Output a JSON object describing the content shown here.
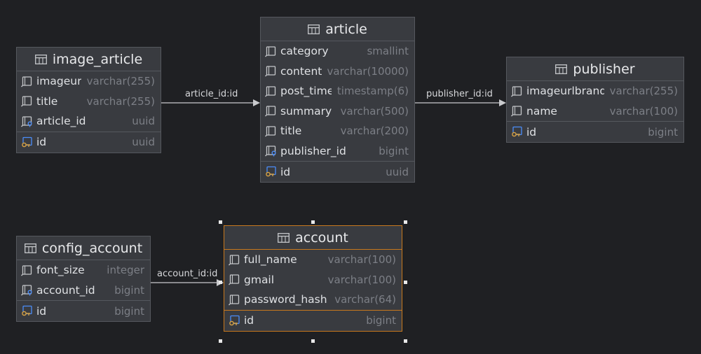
{
  "tables": [
    {
      "id": "image_article",
      "name": "image_article",
      "columns": [
        {
          "name": "imageurl",
          "type": "varchar(255)",
          "icon": "column-icon"
        },
        {
          "name": "title",
          "type": "varchar(255)",
          "icon": "column-icon"
        },
        {
          "name": "article_id",
          "type": "uuid",
          "icon": "foreign-key-column-icon"
        }
      ],
      "primary_key": {
        "name": "id",
        "type": "uuid",
        "icon": "primary-key-icon"
      }
    },
    {
      "id": "article",
      "name": "article",
      "columns": [
        {
          "name": "category",
          "type": "smallint",
          "icon": "column-icon"
        },
        {
          "name": "content",
          "type": "varchar(10000)",
          "icon": "column-icon"
        },
        {
          "name": "post_time",
          "type": "timestamp(6)",
          "icon": "column-icon"
        },
        {
          "name": "summary",
          "type": "varchar(500)",
          "icon": "column-icon"
        },
        {
          "name": "title",
          "type": "varchar(200)",
          "icon": "column-icon"
        },
        {
          "name": "publisher_id",
          "type": "bigint",
          "icon": "foreign-key-column-icon"
        }
      ],
      "primary_key": {
        "name": "id",
        "type": "uuid",
        "icon": "primary-key-icon"
      }
    },
    {
      "id": "publisher",
      "name": "publisher",
      "columns": [
        {
          "name": "imageurlbrand",
          "type": "varchar(255)",
          "icon": "column-icon"
        },
        {
          "name": "name",
          "type": "varchar(100)",
          "icon": "column-icon"
        }
      ],
      "primary_key": {
        "name": "id",
        "type": "bigint",
        "icon": "primary-key-icon"
      }
    },
    {
      "id": "config_account",
      "name": "config_account",
      "columns": [
        {
          "name": "font_size",
          "type": "integer",
          "icon": "column-icon"
        },
        {
          "name": "account_id",
          "type": "bigint",
          "icon": "foreign-key-column-icon"
        }
      ],
      "primary_key": {
        "name": "id",
        "type": "bigint",
        "icon": "primary-key-icon"
      }
    },
    {
      "id": "account",
      "name": "account",
      "selected": true,
      "columns": [
        {
          "name": "full_name",
          "type": "varchar(100)",
          "icon": "column-icon"
        },
        {
          "name": "gmail",
          "type": "varchar(100)",
          "icon": "column-icon"
        },
        {
          "name": "password_hash",
          "type": "varchar(64)",
          "icon": "column-icon"
        }
      ],
      "primary_key": {
        "name": "id",
        "type": "bigint",
        "icon": "primary-key-icon"
      }
    }
  ],
  "relations": [
    {
      "from": "image_article",
      "to": "article",
      "label": "article_id:id"
    },
    {
      "from": "article",
      "to": "publisher",
      "label": "publisher_id:id"
    },
    {
      "from": "config_account",
      "to": "account",
      "label": "account_id:id"
    }
  ],
  "colors": {
    "background": "#1f2023",
    "card": "#393b40",
    "border": "#55585e",
    "selection": "#c8781d",
    "key_blue": "#4b8df8",
    "key_gold": "#d9a343"
  }
}
